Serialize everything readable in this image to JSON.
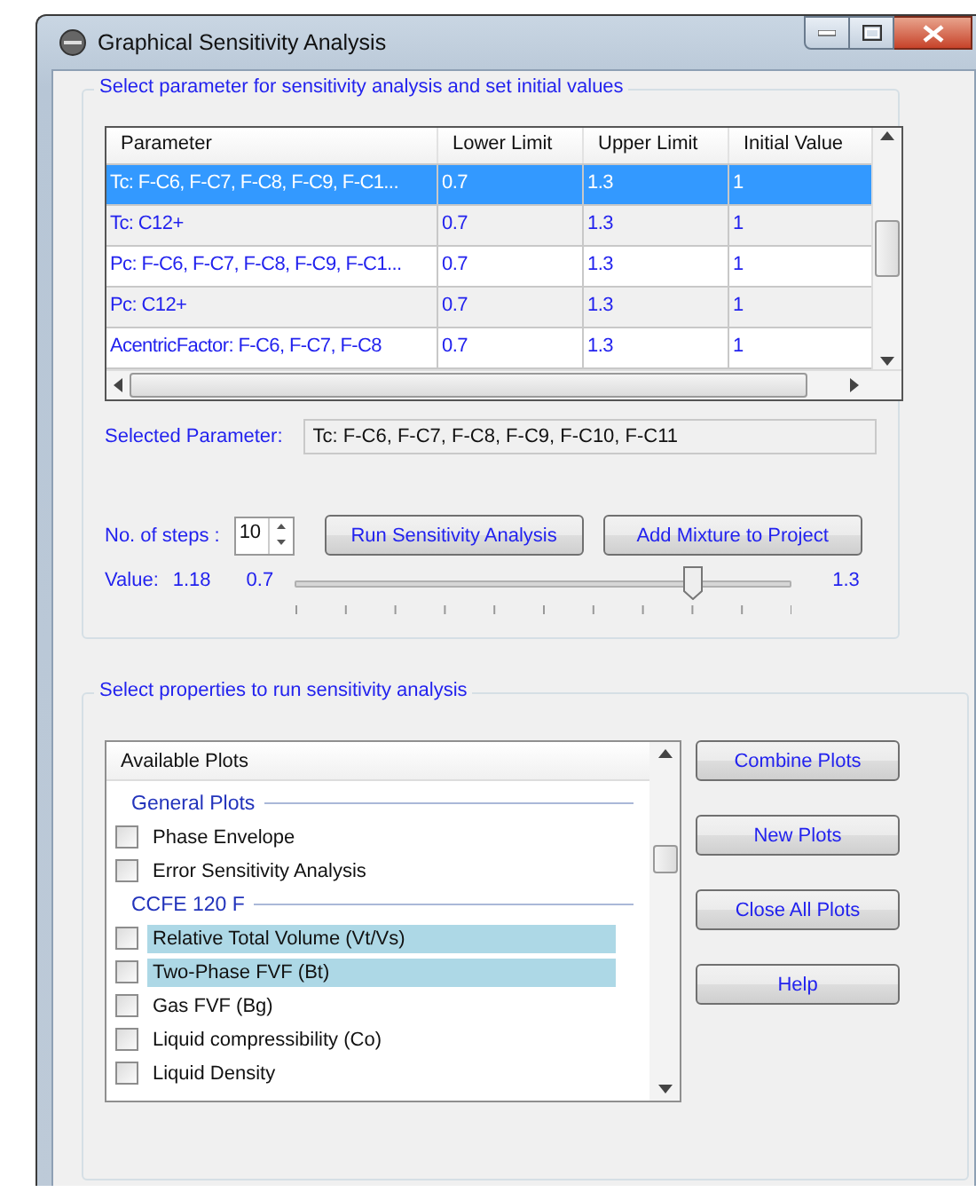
{
  "window": {
    "title": "Graphical Sensitivity Analysis"
  },
  "parameters_group": {
    "title": "Select parameter for sensitivity analysis and set initial values",
    "table": {
      "columns": [
        "Parameter",
        "Lower Limit",
        "Upper Limit",
        "Initial Value"
      ],
      "rows": [
        {
          "cells": [
            "Tc: F-C6, F-C7, F-C8, F-C9, F-C1...",
            "0.7",
            "1.3",
            "1"
          ],
          "selected": true
        },
        {
          "cells": [
            "Tc: C12+",
            "0.7",
            "1.3",
            "1"
          ],
          "selected": false
        },
        {
          "cells": [
            "Pc: F-C6, F-C7, F-C8, F-C9, F-C1...",
            "0.7",
            "1.3",
            "1"
          ],
          "selected": false
        },
        {
          "cells": [
            "Pc: C12+",
            "0.7",
            "1.3",
            "1"
          ],
          "selected": false
        },
        {
          "cells": [
            "AcentricFactor: F-C6, F-C7, F-C8",
            "0.7",
            "1.3",
            "1"
          ],
          "selected": false
        }
      ]
    },
    "selected_parameter": {
      "label": "Selected Parameter:",
      "value": "Tc: F-C6, F-C7, F-C8, F-C9, F-C10, F-C11"
    },
    "steps": {
      "label": "No. of steps :",
      "value": "10"
    },
    "buttons": [
      "Run Sensitivity Analysis",
      "Add Mixture to Project"
    ],
    "slider": {
      "label": "Value:",
      "value": "1.18",
      "min_label": "0.7",
      "max_label": "1.3",
      "level": 0.8
    }
  },
  "properties_group": {
    "title": "Select properties to run sensitivity analysis",
    "list": {
      "header": "Available Plots",
      "items": [
        {
          "kind": "group",
          "label": "General Plots"
        },
        {
          "kind": "check",
          "label": "Phase Envelope",
          "checked": false,
          "highlighted": false
        },
        {
          "kind": "check",
          "label": "Error Sensitivity Analysis",
          "checked": false,
          "highlighted": false
        },
        {
          "kind": "group",
          "label": "CCFE 120 F"
        },
        {
          "kind": "check",
          "label": "Relative Total Volume (Vt/Vs)",
          "checked": false,
          "highlighted": true
        },
        {
          "kind": "check",
          "label": "Two-Phase FVF (Bt)",
          "checked": false,
          "highlighted": true
        },
        {
          "kind": "check",
          "label": "Gas FVF (Bg)",
          "checked": false,
          "highlighted": false
        },
        {
          "kind": "check",
          "label": "Liquid compressibility (Co)",
          "checked": false,
          "highlighted": false
        },
        {
          "kind": "check",
          "label": "Liquid Density",
          "checked": false,
          "highlighted": false
        }
      ]
    },
    "buttons": [
      "Combine Plots",
      "New Plots",
      "Close All Plots",
      "Help"
    ]
  }
}
